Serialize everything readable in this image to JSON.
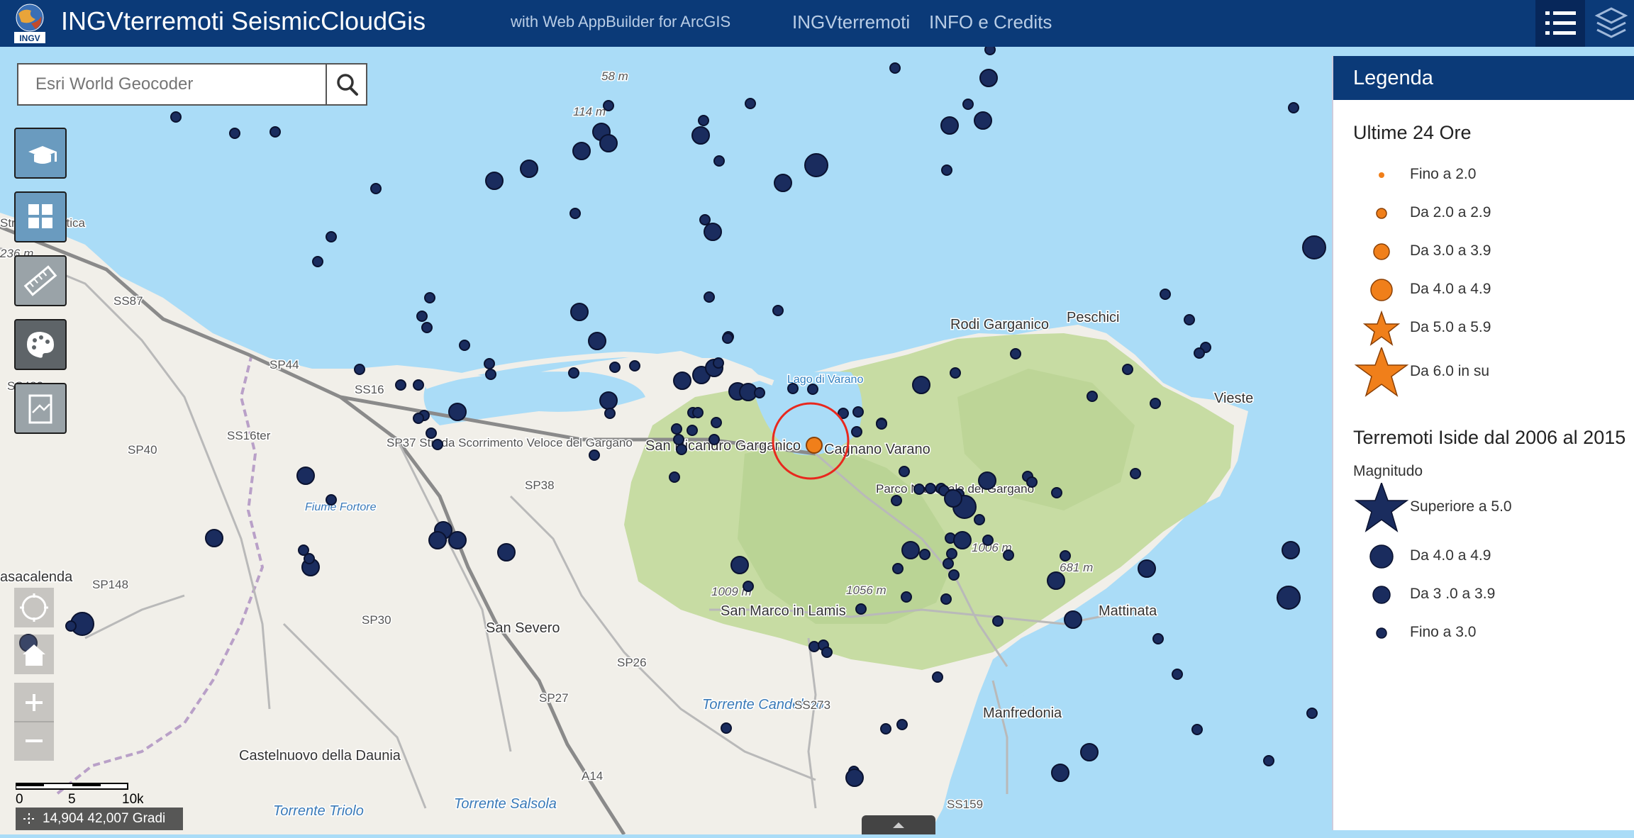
{
  "header": {
    "title": "INGVterremoti SeismicCloudGis",
    "subtitle": "with Web AppBuilder for ArcGIS",
    "links": [
      "INGVterremoti",
      "INFO e Credits"
    ],
    "logo_text": "INGV",
    "legend_button_icon": "list-icon",
    "layers_button_icon": "layers-icon",
    "bg_color": "#0b3a78"
  },
  "search": {
    "placeholder": "Esri World Geocoder",
    "icon": "search-icon"
  },
  "tools": [
    {
      "name": "about-tool",
      "icon": "graduation-cap-icon"
    },
    {
      "name": "basemap-tool",
      "icon": "grid-icon"
    },
    {
      "name": "measure-tool",
      "icon": "ruler-icon"
    },
    {
      "name": "draw-tool",
      "icon": "palette-icon"
    },
    {
      "name": "print-tool",
      "icon": "print-icon"
    }
  ],
  "legend": {
    "title": "Legenda",
    "section1": {
      "title": "Ultime 24 Ore",
      "items": [
        "Fino a 2.0",
        "Da 2.0 a 2.9",
        "Da 3.0 a 3.9",
        "Da 4.0 a 4.9",
        "Da 5.0 a 5.9",
        "Da 6.0 in su"
      ]
    },
    "section2": {
      "title": "Terremoti Iside dal 2006 al 2015",
      "subtitle": "Magnitudo",
      "items": [
        "Superiore a 5.0",
        "Da 4.0 a 4.9",
        "Da 3 .0 a 3.9",
        "Fino a 3.0"
      ]
    },
    "colors": {
      "recent": "#f07f1a",
      "historic": "#1a2c5e"
    }
  },
  "map": {
    "places": [
      "Rodi Garganico",
      "Peschici",
      "Vieste",
      "San Nicandro Garganico",
      "Cagnano Varano",
      "Lago di Varano",
      "Parco Nazionale del Gargano",
      "San Marco in Lamis",
      "Mattinata",
      "Manfredonia",
      "San Severo",
      "Castelnuovo della Daunia",
      "asacalenda",
      "Torrente Triolo",
      "Torrente Salsola",
      "Torrente Candelaro",
      "Fiume Fortore"
    ],
    "roads": [
      "Strada Adriatica",
      "SS87",
      "SP44",
      "SS16",
      "SP40",
      "SS483",
      "SP37 Strada Scorrimento Veloce del Gargano",
      "SP38",
      "SP148",
      "SP30",
      "SP26",
      "SP27",
      "SS273",
      "SS159",
      "A14",
      "SS16ter"
    ],
    "elevations": [
      "58 m",
      "114 m",
      "236 m",
      "1009 m",
      "1056 m",
      "1006 m",
      "681 m"
    ]
  },
  "scale": {
    "labels": [
      "0",
      "5",
      "10km"
    ],
    "coords": "14,904 42,007 Gradi"
  }
}
